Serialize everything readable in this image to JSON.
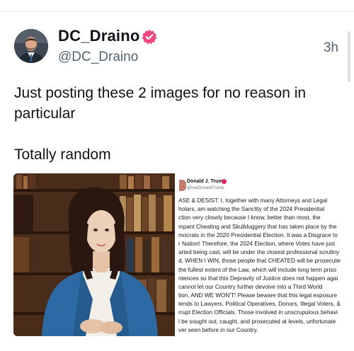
{
  "post": {
    "display_name": "DC_Draino",
    "handle": "@DC_Draino",
    "timestamp": "3h",
    "text_line1": "Just posting these 2 images for no reason in particular",
    "text_line2": "Totally random"
  },
  "icons": {
    "verified": "verified-badge-icon",
    "avatar": "user-avatar"
  },
  "colors": {
    "verified_badge": "#f0487e",
    "secondary_text": "#536471",
    "primary_text": "#0f1419"
  },
  "embedded_post": {
    "author_name": "Donald J. Trump",
    "author_handle": "@realDonaldTrump",
    "body_lines": [
      "ASE & DESIST: I, together with many Attorneys and Legal",
      "holars, am watching the Sanctity of the 2024 Presidential",
      "ction very closely because I know, better than most, the",
      "mpant Cheating and Skullduggery that has taken place by the",
      "mocrats in the 2020 Presidential Election. It was a Disgrace to",
      "r Nation! Therefore, the 2024 Election, where Votes have just",
      "arted being cast, will be under the closest professional scrutiny",
      "d, WHEN I WIN, those people that CHEATED will be prosecuted",
      "the fullest extent of the Law, which will include long term priso",
      "ntences so that this Depravity of Justice does not happen agai",
      "cannot let our Country further devolve into a Third World",
      "tion, AND WE WON'T! Please beware that this legal exposure",
      "tends to Lawyers, Political Operatives, Donors, Illegal Voters, &",
      "rrupt Election Officials. Those involved in unscrupulous behavi",
      "l be sought out, caught, and prosecuted at levels, unfortunate",
      "ver seen before in our Country."
    ]
  }
}
